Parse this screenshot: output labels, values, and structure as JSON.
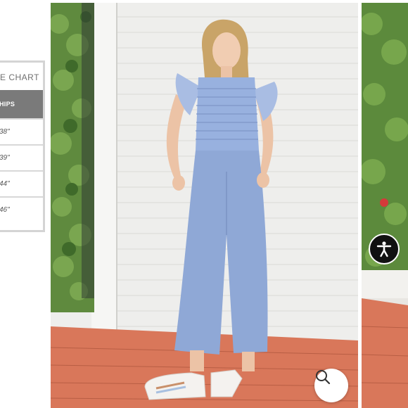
{
  "size_chart": {
    "title": "E CHART",
    "header": "HIPS",
    "rows": [
      "38\"",
      "39\"",
      "44\"",
      "46\""
    ]
  },
  "main_image": {
    "alt": "Woman in blue smocked ruffle-sleeve wide-leg jumpsuit"
  },
  "controls": {
    "zoom": {
      "icon": "search-icon"
    },
    "accessibility": {
      "icon": "accessibility-person-icon"
    }
  },
  "colors": {
    "accent_dark": "#111111",
    "chart_header": "#7a7a7a",
    "jumpsuit_blue": "#8fa8d6",
    "brick_floor": "#d9775a"
  }
}
